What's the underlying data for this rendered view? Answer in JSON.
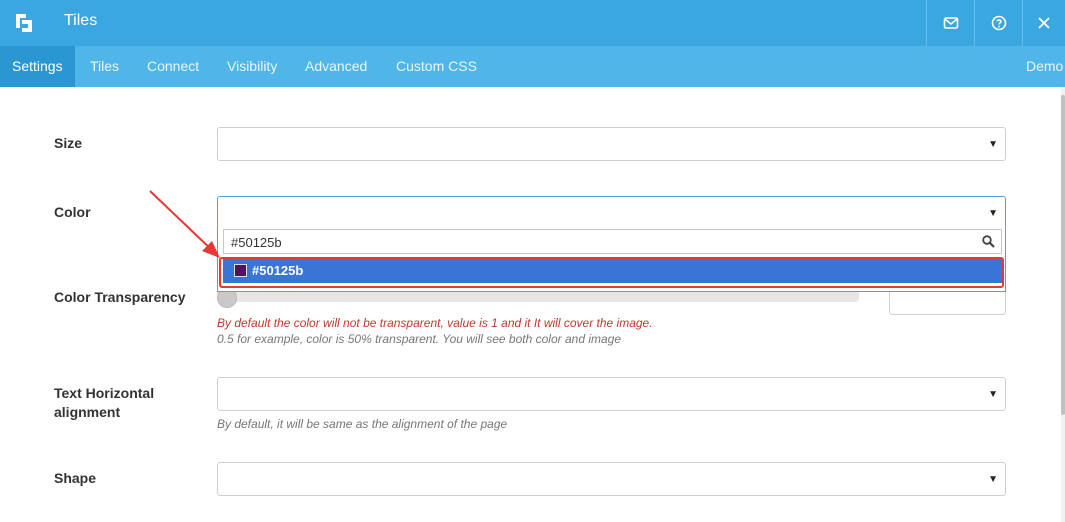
{
  "window": {
    "title": "Tiles",
    "icons": [
      "logo-icon",
      "mail-icon",
      "help-icon",
      "close-icon"
    ]
  },
  "tabs": [
    {
      "label": "Settings",
      "active": true
    },
    {
      "label": "Tiles"
    },
    {
      "label": "Connect"
    },
    {
      "label": "Visibility"
    },
    {
      "label": "Advanced"
    },
    {
      "label": "Custom CSS"
    },
    {
      "label": "Demo"
    }
  ],
  "form": {
    "size": {
      "label": "Size",
      "value": ""
    },
    "color": {
      "label": "Color",
      "value": "",
      "search_value": "#50125b",
      "option": {
        "label": "#50125b",
        "swatch_color": "#50125b"
      }
    },
    "transparency": {
      "label": "Color Transparency",
      "help_red": "By default the color will not be transparent, value is 1 and it It will cover the image.",
      "help_gray": "0.5 for example, color is 50% transparent. You will see both color and image"
    },
    "text_align": {
      "label_line1": "Text Horizontal",
      "label_line2": "alignment",
      "value": "",
      "help": "By default, it will be same as the alignment of the page"
    },
    "shape": {
      "label": "Shape",
      "value": ""
    }
  },
  "colors": {
    "titlebar": "#3aa7e0",
    "tabbar": "#50b5e8",
    "tab_active": "#2a96d2",
    "option_highlight": "#3875d7",
    "annotation": "#e53935"
  }
}
